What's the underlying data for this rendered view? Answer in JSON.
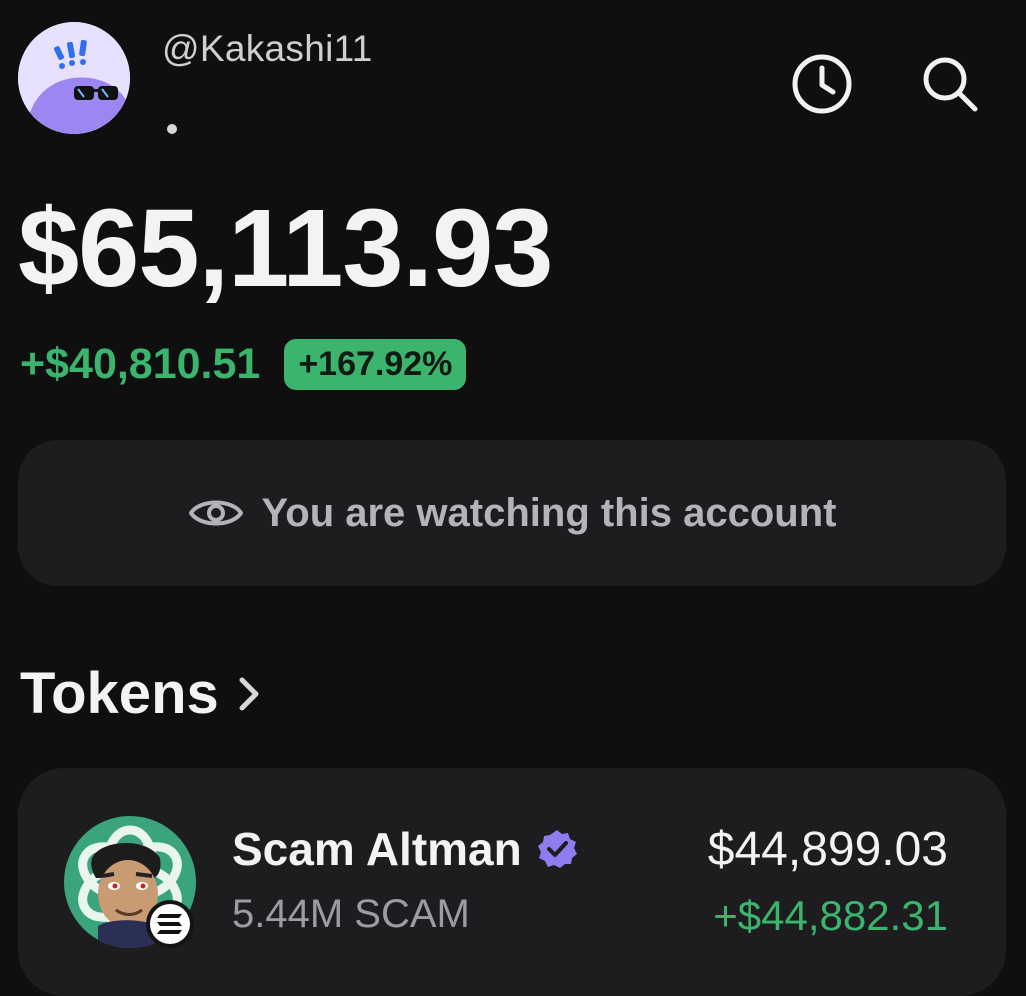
{
  "profile": {
    "handle": "@Kakashi11",
    "avatar_icon": "ghost-sunglasses-avatar",
    "avatar_bg": "#e7e1ff",
    "avatar_accent": "#9b86f2"
  },
  "header_actions": {
    "history_icon": "clock-icon",
    "search_icon": "search-icon"
  },
  "portfolio": {
    "balance": "$65,113.93",
    "change_value": "+$40,810.51",
    "change_percent": "+167.92%",
    "positive_color": "#3bb46e"
  },
  "watch_banner": {
    "icon": "eye-icon",
    "text": "You are watching this account"
  },
  "tokens_section": {
    "title": "Tokens",
    "chevron_icon": "chevron-right-icon"
  },
  "tokens": [
    {
      "name": "Scam Altman",
      "verified_icon": "verified-badge-icon",
      "verified_color": "#8e7cf0",
      "amount": "5.44M SCAM",
      "value": "$44,899.03",
      "change": "+$44,882.31",
      "logo_icon": "scam-altman-token-logo",
      "chain_icon": "solana-chain-icon"
    }
  ]
}
